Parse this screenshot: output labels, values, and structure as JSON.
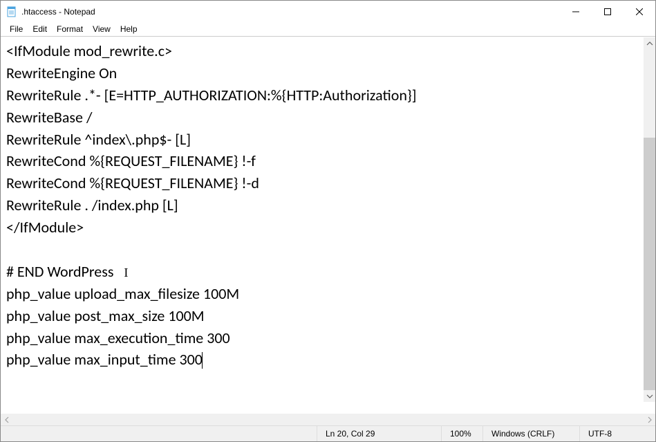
{
  "window": {
    "title": ".htaccess - Notepad"
  },
  "menu": {
    "file": "File",
    "edit": "Edit",
    "format": "Format",
    "view": "View",
    "help": "Help"
  },
  "content": {
    "lines": [
      "<IfModule mod_rewrite.c>",
      "RewriteEngine On",
      "RewriteRule .*- [E=HTTP_AUTHORIZATION:%{HTTP:Authorization}]",
      "RewriteBase /",
      "RewriteRule ^index\\.php$- [L]",
      "RewriteCond %{REQUEST_FILENAME} !-f",
      "RewriteCond %{REQUEST_FILENAME} !-d",
      "RewriteRule . /index.php [L]",
      "</IfModule>",
      "",
      "# END WordPress",
      "php_value upload_max_filesize 100M",
      "php_value post_max_size 100M",
      "php_value max_execution_time 300",
      "php_value max_input_time 300"
    ]
  },
  "status": {
    "position": "Ln 20, Col 29",
    "zoom": "100%",
    "line_ending": "Windows (CRLF)",
    "encoding": "UTF-8"
  }
}
